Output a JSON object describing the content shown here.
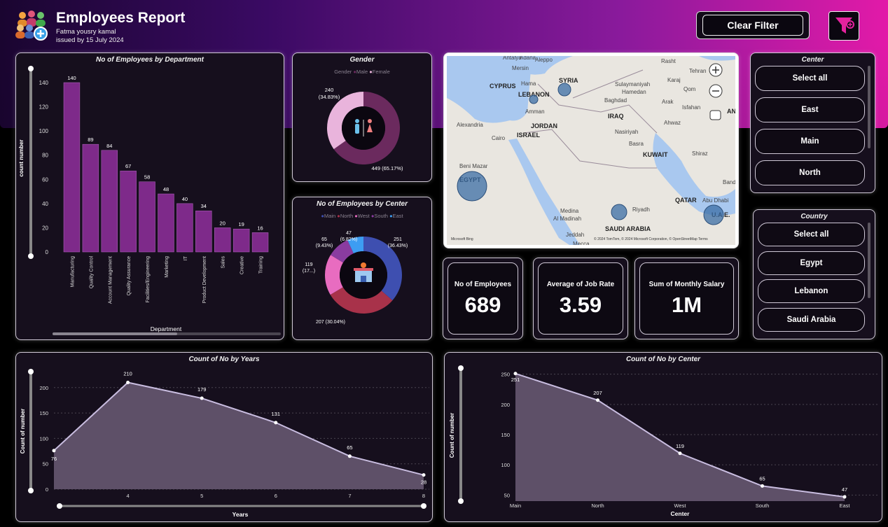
{
  "header": {
    "title": "Employees Report",
    "author": "Fatma yousry kamal",
    "issued": "issued by 15 July  2024",
    "clear_filter_label": "Clear Filter",
    "gradient_colors": [
      "#1a0530",
      "#3a0a63",
      "#8a1a9c",
      "#e21aa8"
    ]
  },
  "colors": {
    "purple_bar": "#7e2a8a",
    "panel_bg": "#160f1d",
    "area_fill": "#5e5068",
    "area_line": "#c9bde0"
  },
  "dept_chart": {
    "title": "No of Employees by Department",
    "ylabel": "count number",
    "xlabel": "Department"
  },
  "gender_chart": {
    "title": "Gender",
    "legend_title": "Gender",
    "legend": [
      "Male",
      "Female"
    ],
    "label_female": [
      "240",
      "(34.83%)"
    ],
    "label_male": "449 (65.17%)"
  },
  "center_chart": {
    "title": "No of Employees by Center",
    "legend": [
      "Main",
      "North",
      "West",
      "South",
      "East"
    ],
    "labels": {
      "main": [
        "251",
        "(36.43%)"
      ],
      "north": "207 (30.04%)",
      "west": [
        "119",
        "(17...)"
      ],
      "south": [
        "65",
        "(9.43%)"
      ],
      "east": [
        "47",
        "(6.82%)"
      ]
    }
  },
  "map": {
    "labels": [
      "Antalya",
      "Adana",
      "Aleppo",
      "Mersin",
      "Rasht",
      "Tehran",
      "Hama",
      "SYRIA",
      "Sulaymaniyah",
      "Karaj",
      "Hamedan",
      "Qom",
      "CYPRUS",
      "LEBANON",
      "Arak",
      "Baghdad",
      "Isfahan",
      "AN",
      "Amman",
      "JORDAN",
      "IRAQ",
      "Alexandria",
      "Ahwaz",
      "Cairo",
      "ISRAEL",
      "Nasiriyah",
      "Basra",
      "KUWAIT",
      "Shiraz",
      "Beni Mazar",
      "EGYPT",
      "Bandar",
      "Abu Dhabi",
      "QATAR",
      "Riyadh",
      "U.A.E.",
      "Medina",
      "Al Madinah",
      "SAUDI ARABIA",
      "Jeddah",
      "Mecca"
    ],
    "copyright": "© 2024 TomTom, © 2024 Microsoft Corporation, © OpenStreetMap  Terms",
    "brand": "Microsoft Bing"
  },
  "center_slicer": {
    "title": "Center",
    "items": [
      "Select all",
      "East",
      "Main",
      "North"
    ]
  },
  "country_slicer": {
    "title": "Country",
    "items": [
      "Select all",
      "Egypt",
      "Lebanon",
      "Saudi Arabia"
    ]
  },
  "kpis": [
    {
      "label": "No of Employees",
      "value": "689"
    },
    {
      "label": "Average of Job Rate",
      "value": "3.59"
    },
    {
      "label": "Sum of Monthly Salary",
      "value": "1M"
    }
  ],
  "chart_data": [
    {
      "type": "bar",
      "title": "No of Employees by Department",
      "xlabel": "Department",
      "ylabel": "count number",
      "categories": [
        "Manufacturing",
        "Quality Control",
        "Account Management",
        "Quality Assurance",
        "Facilities/Engineering",
        "Marketing",
        "IT",
        "Product Development",
        "Sales",
        "Creative",
        "Training"
      ],
      "values": [
        140,
        89,
        84,
        67,
        58,
        48,
        40,
        34,
        20,
        19,
        16
      ],
      "yticks": [
        0,
        20,
        40,
        60,
        80,
        100,
        120,
        140
      ],
      "ylim": [
        0,
        140
      ]
    },
    {
      "type": "pie",
      "title": "Gender",
      "categories": [
        "Male",
        "Female"
      ],
      "values": [
        449,
        240
      ],
      "colors": [
        "#6b2a5e",
        "#e9b4dc"
      ]
    },
    {
      "type": "pie",
      "title": "No of Employees by Center",
      "categories": [
        "Main",
        "North",
        "West",
        "South",
        "East"
      ],
      "values": [
        251,
        207,
        119,
        65,
        47
      ],
      "colors": [
        "#3e4fb0",
        "#a8324a",
        "#e86cc0",
        "#8a3ca0",
        "#3d9df2"
      ]
    },
    {
      "type": "area",
      "title": "Count of No by Years",
      "xlabel": "Years",
      "ylabel": "Count of number",
      "x": [
        3,
        4,
        5,
        6,
        7,
        8
      ],
      "values": [
        76,
        210,
        179,
        131,
        65,
        28
      ],
      "xticks": [
        4,
        5,
        6,
        7,
        8
      ],
      "yticks": [
        0,
        50,
        100,
        150,
        200
      ],
      "ylim": [
        0,
        230
      ]
    },
    {
      "type": "area",
      "title": "Count of No by Center",
      "xlabel": "Center",
      "ylabel": "Count of number",
      "categories": [
        "Main",
        "North",
        "West",
        "South",
        "East"
      ],
      "values": [
        251,
        207,
        119,
        65,
        47
      ],
      "yticks": [
        50,
        100,
        150,
        200,
        250
      ],
      "ylim": [
        40,
        260
      ]
    }
  ]
}
